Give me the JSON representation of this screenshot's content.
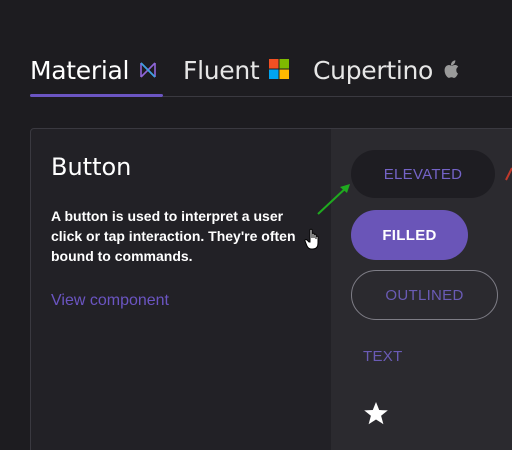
{
  "tabs": [
    {
      "label": "Material",
      "icon": "material-logo-icon",
      "active": true
    },
    {
      "label": "Fluent",
      "icon": "windows-logo-icon",
      "active": false
    },
    {
      "label": "Cupertino",
      "icon": "apple-logo-icon",
      "active": false
    }
  ],
  "card": {
    "title": "Button",
    "description": "A button is used to interpret a user click or tap interaction. They're often bound to commands.",
    "link": "View component"
  },
  "buttons": {
    "elevated": "ELEVATED",
    "filled": "FILLED",
    "outlined": "OUTLINED",
    "text": "TEXT",
    "icon": "star-icon"
  },
  "colors": {
    "accent": "#6b55c2",
    "background": "#1d1c20",
    "card": "#222126",
    "preview_panel": "#2b2a2f",
    "annotation_arrow": "#1faa1f"
  }
}
